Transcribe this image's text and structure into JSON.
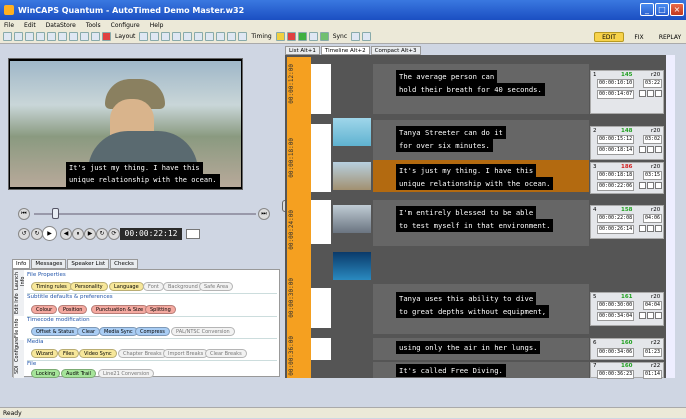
{
  "window": {
    "title": "WinCAPS Quantum - AutoTimed Demo Master.w32"
  },
  "menu": [
    "File",
    "Edit",
    "DataStore",
    "Tools",
    "Configure",
    "Help"
  ],
  "toolbar": {
    "layout_label": "Layout",
    "timing_label": "Timing",
    "sync_label": "Sync"
  },
  "modes": [
    "EDIT",
    "FIX",
    "REPLAY"
  ],
  "video": {
    "subtitle_line1": "It's just my thing. I have this",
    "subtitle_line2": "unique relationship with the ocean."
  },
  "transport": {
    "timecode": "00:00:22:12"
  },
  "left_tabs": [
    "Info",
    "Messages",
    "Speaker List",
    "Checks"
  ],
  "vertical_tabs": [
    "Launch Info",
    "Edit Info",
    "File Info",
    "Configure",
    "SDI"
  ],
  "groups": {
    "file_properties": {
      "title": "File Properties",
      "chips": [
        "Timing rules",
        "Personality",
        "Language",
        "Font",
        "Background",
        "Safe Area"
      ]
    },
    "subtitle_defaults": {
      "title": "Subtitle defaults & preferences",
      "chips": [
        "Colour",
        "Position",
        "Punctuation & Size",
        "Splitting"
      ]
    },
    "timecode": {
      "title": "Timecode modification",
      "chips": [
        "Offset & Status",
        "Clear",
        "Media Sync",
        "Compress",
        "PAL/NTSC Conversion"
      ]
    },
    "media": {
      "title": "Media",
      "chips": [
        "Wizard",
        "Files",
        "Video Sync",
        "Chapter Breaks",
        "Import Breaks",
        "Clear Breaks"
      ]
    },
    "file": {
      "title": "File",
      "chips": [
        "Locking",
        "Audit Trail",
        "Line21 Conversion"
      ]
    }
  },
  "right_tabs": [
    "List Alt+1",
    "Timeline Alt+2",
    "Compact Alt+3"
  ],
  "ruler_labels": [
    "00:00:12:00",
    "00:00:18:00",
    "00:00:24:00",
    "00:00:30:00",
    "00:00:36:00"
  ],
  "subtitles": [
    {
      "num": "1",
      "count": "145",
      "cap": "r20",
      "in": "00:00:10:10",
      "dur": "03:22",
      "out": "00:00:14:07",
      "line1": "The average person can",
      "line2": "hold their breath for 40 seconds."
    },
    {
      "num": "2",
      "count": "148",
      "cap": "r20",
      "in": "00:00:15:12",
      "dur": "03:02",
      "out": "00:00:18:14",
      "line1": "Tanya Streeter can do it",
      "line2": "for over six minutes."
    },
    {
      "num": "3",
      "count": "186",
      "cap": "r20",
      "in": "00:00:18:18",
      "dur": "03:15",
      "out": "00:00:22:06",
      "line1": "It's just my thing. I have this",
      "line2": "unique relationship with the ocean."
    },
    {
      "num": "4",
      "count": "158",
      "cap": "r20",
      "in": "00:00:22:08",
      "dur": "04:06",
      "out": "00:00:26:14",
      "line1": "I'm entirely blessed to be able",
      "line2": "to test myself in that environment."
    },
    {
      "num": "5",
      "count": "161",
      "cap": "r20",
      "in": "00:00:30:00",
      "dur": "04:04",
      "out": "00:00:34:04",
      "line1": "Tanya uses this ability to dive",
      "line2": "to great depths without equipment,"
    },
    {
      "num": "6",
      "count": "160",
      "cap": "r22",
      "in": "00:00:34:06",
      "dur": "01:23",
      "out": "",
      "line1": "using only the air in her lungs.",
      "line2": ""
    },
    {
      "num": "7",
      "count": "160",
      "cap": "r22",
      "in": "00:00:36:23",
      "dur": "01:14",
      "out": "",
      "line1": "It's called Free Diving.",
      "line2": ""
    }
  ],
  "status": {
    "text": "Ready"
  },
  "colors": {
    "accent_orange": "#f5a020",
    "edit_mode": "#f7d24a",
    "current_row": "#b36a10"
  }
}
